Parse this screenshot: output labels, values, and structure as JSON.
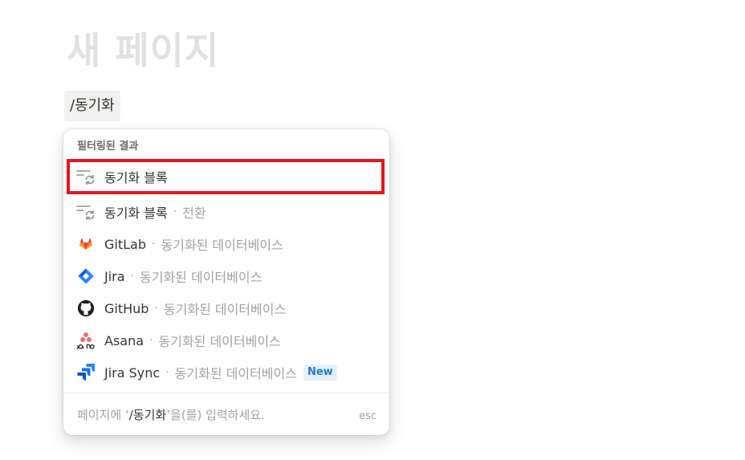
{
  "page": {
    "title": "새 페이지",
    "slash_command": "/동기화"
  },
  "menu": {
    "section_header": "필터링된 결과",
    "items": [
      {
        "label": "동기화 블록",
        "desc": "",
        "icon": "sync-block-icon"
      },
      {
        "label": "동기화 블록",
        "desc": "전환",
        "icon": "sync-block-icon"
      },
      {
        "label": "GitLab",
        "desc": "동기화된 데이터베이스",
        "icon": "gitlab-icon"
      },
      {
        "label": "Jira",
        "desc": "동기화된 데이터베이스",
        "icon": "jira-icon"
      },
      {
        "label": "GitHub",
        "desc": "동기화된 데이터베이스",
        "icon": "github-icon"
      },
      {
        "label": "Asana",
        "desc": "동기화된 데이터베이스",
        "icon": "asana-icon"
      },
      {
        "label": "Jira Sync",
        "desc": "동기화된 데이터베이스",
        "icon": "jira-sync-icon",
        "badge": "New"
      }
    ],
    "separator": "·",
    "footer": {
      "prefix": "페이지에 ‘",
      "query": "/동기화",
      "suffix": "’을(를) 입력하세요.",
      "esc": "esc"
    }
  },
  "colors": {
    "highlight": "#e3171d",
    "badge_bg": "#e3f1fb",
    "badge_text": "#1f7ad1",
    "gitlab": "#e24329",
    "jira": "#2684ff",
    "asana": "#f06a6a"
  }
}
